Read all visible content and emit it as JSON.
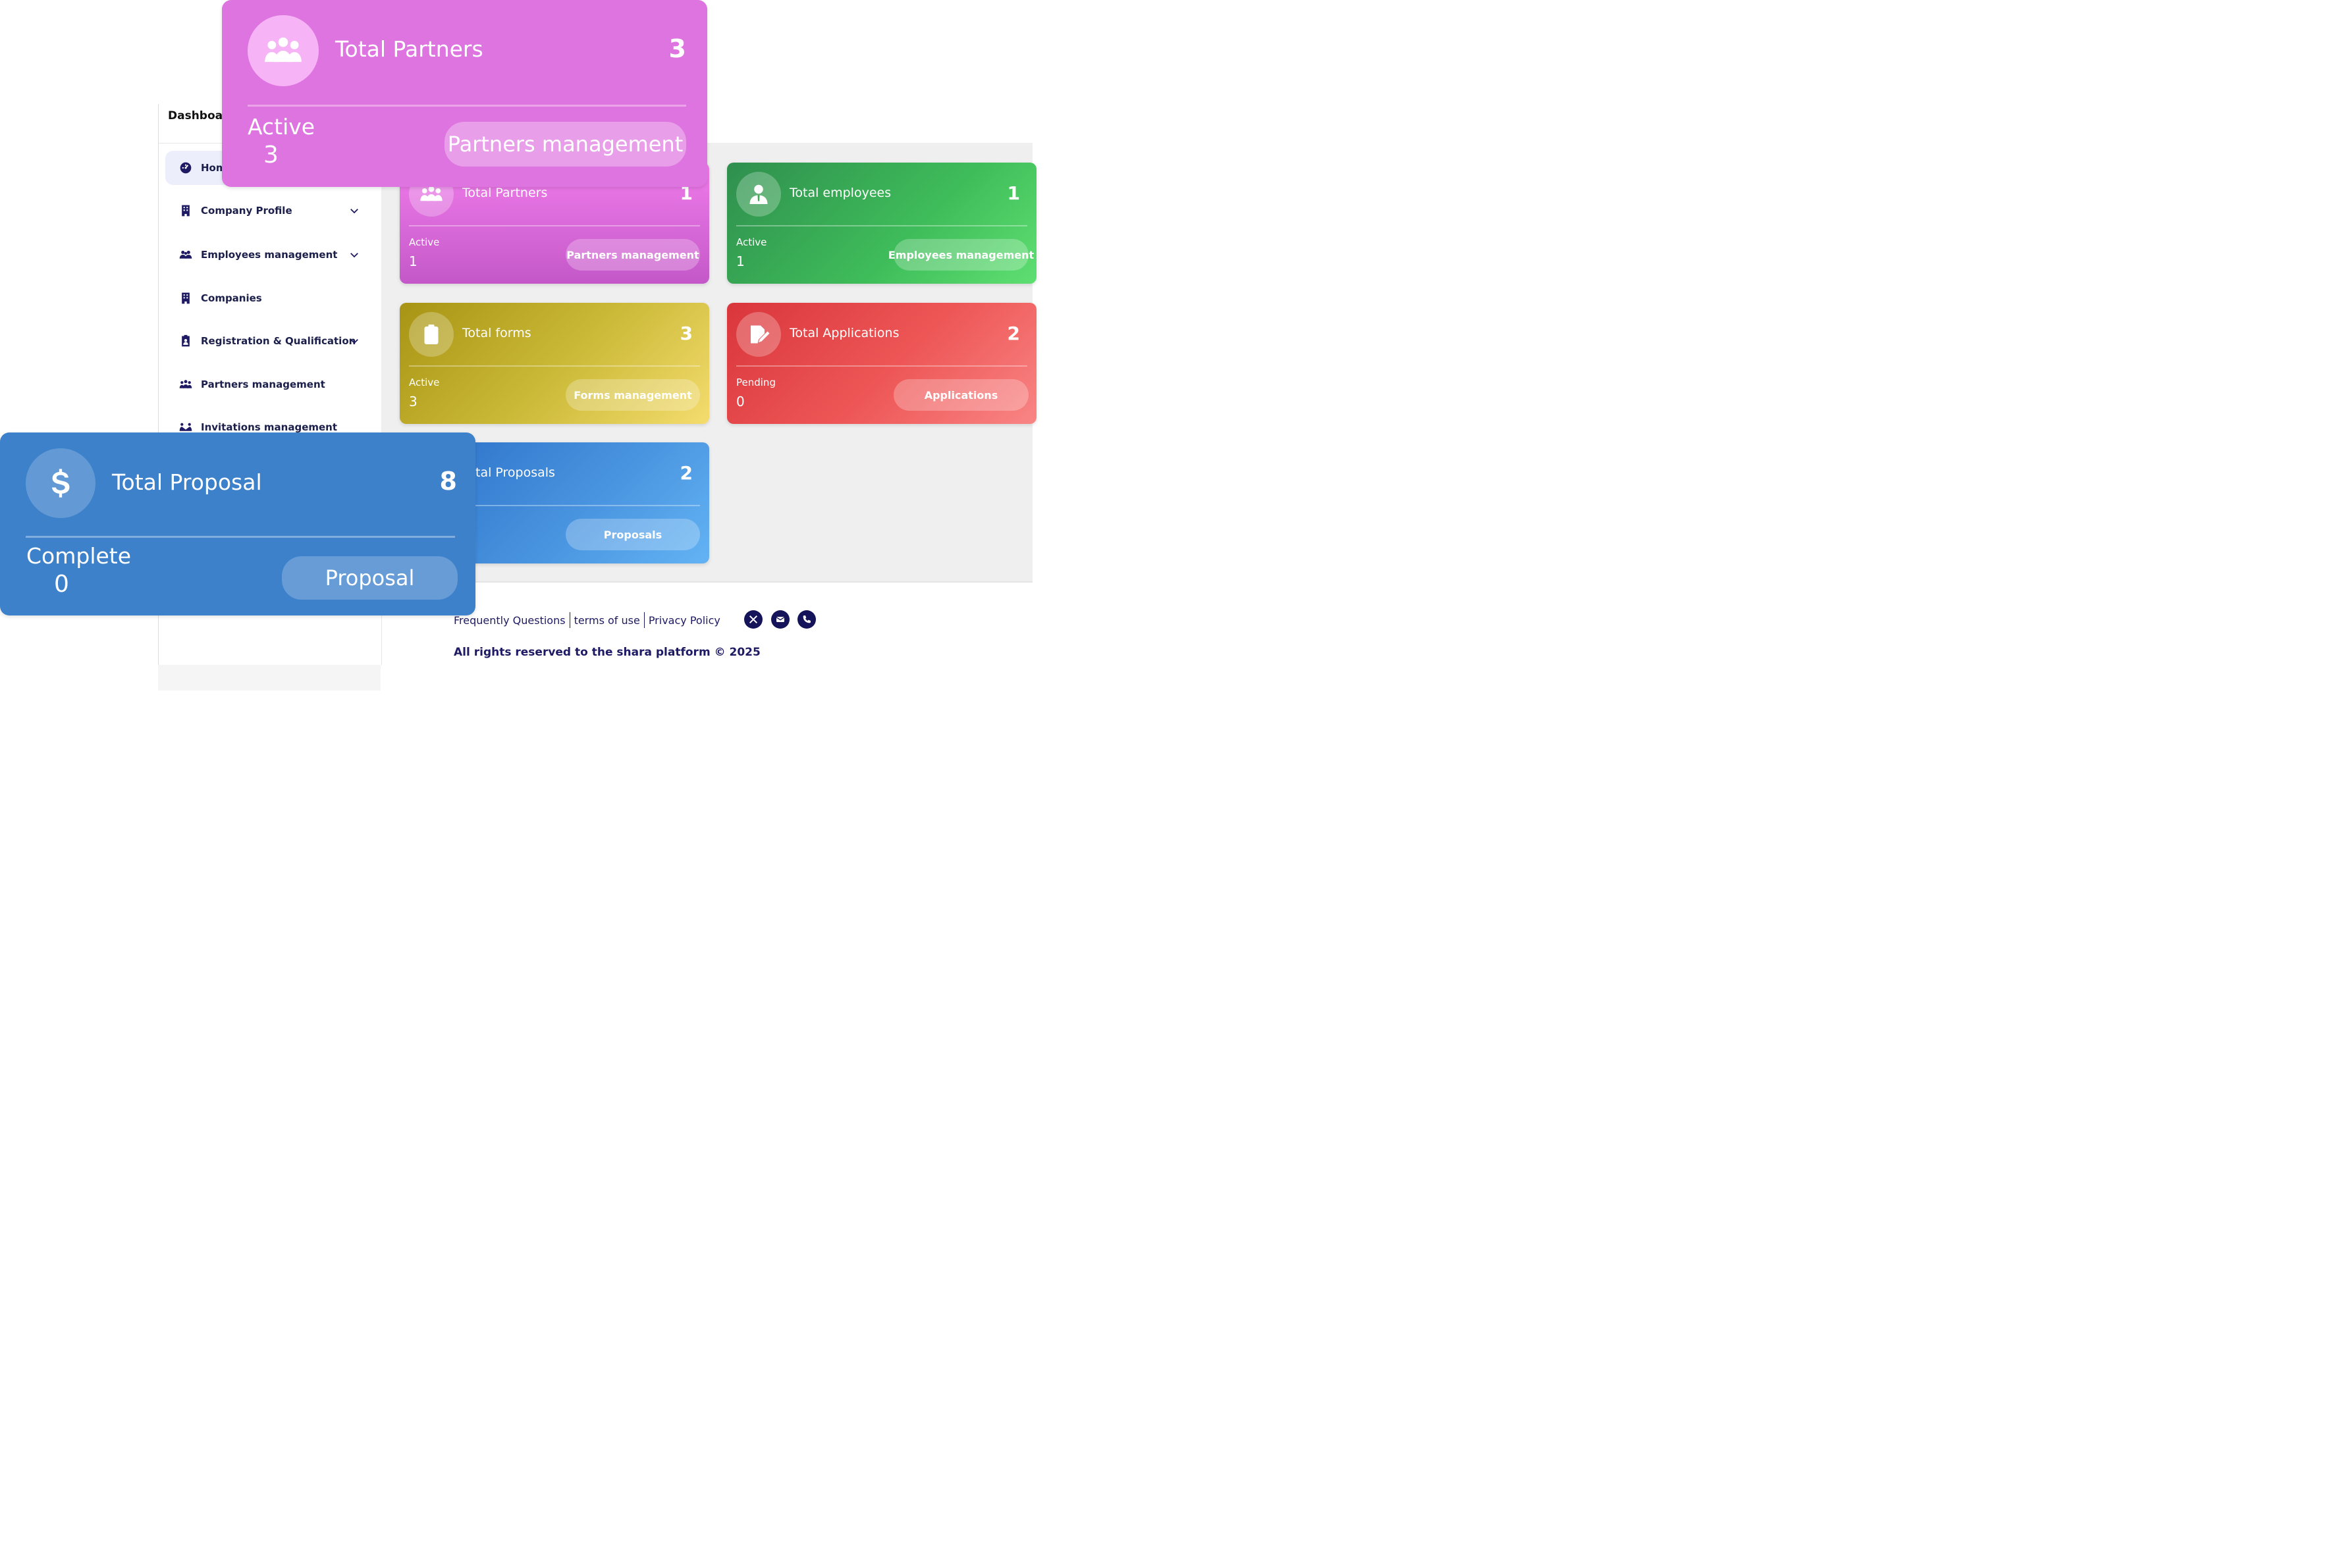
{
  "sidebar": {
    "title": "Dashboard",
    "items": [
      {
        "label": "Home",
        "icon": "dashboard-icon",
        "active": true
      },
      {
        "label": "Company Profile",
        "icon": "building-icon",
        "expandable": true
      },
      {
        "label": "Employees management",
        "icon": "users-icon",
        "expandable": true
      },
      {
        "label": "Companies",
        "icon": "building-icon"
      },
      {
        "label": "Registration & Qualification",
        "icon": "badge-icon",
        "expandable": true
      },
      {
        "label": "Partners management",
        "icon": "group-icon"
      },
      {
        "label": "Invitations management",
        "icon": "handshake-icon"
      }
    ]
  },
  "cards": {
    "partners": {
      "title": "Total Partners",
      "count": "1",
      "sub_label": "Active",
      "sub_value": "1",
      "button": "Partners management",
      "icon": "group-icon"
    },
    "employees": {
      "title": "Total employees",
      "count": "1",
      "sub_label": "Active",
      "sub_value": "1",
      "button": "Employees management",
      "icon": "employee-icon"
    },
    "forms": {
      "title": "Total forms",
      "count": "3",
      "sub_label": "Active",
      "sub_value": "3",
      "button": "Forms management",
      "icon": "clipboard-icon"
    },
    "applications": {
      "title": "Total Applications",
      "count": "2",
      "sub_label": "Pending",
      "sub_value": "0",
      "button": "Applications",
      "icon": "signature-icon"
    },
    "proposals": {
      "title": "Total Proposals",
      "count": "2",
      "button": "Proposals",
      "icon": "dollar-icon"
    }
  },
  "zoom_cards": {
    "partners": {
      "title": "Total Partners",
      "count": "3",
      "sub_label": "Active",
      "sub_value": "3",
      "button": "Partners management",
      "icon": "group-icon"
    },
    "proposal": {
      "title": "Total Proposal",
      "count": "8",
      "sub_label": "Complete",
      "sub_value": "0",
      "button": "Proposal",
      "icon": "dollar-icon"
    }
  },
  "footer": {
    "links": [
      "Frequently Questions",
      "terms of use",
      "Privacy Policy"
    ],
    "social": [
      "x-icon",
      "mail-icon",
      "phone-icon"
    ],
    "copyright": "All rights reserved to the shara platform © 2025"
  },
  "colors": {
    "primary": "#1e1a63",
    "partners": "#e57ae4",
    "employees": "#3cab55",
    "forms": "#cdb937",
    "applications": "#ec5454",
    "proposals": "#4a95e0"
  }
}
